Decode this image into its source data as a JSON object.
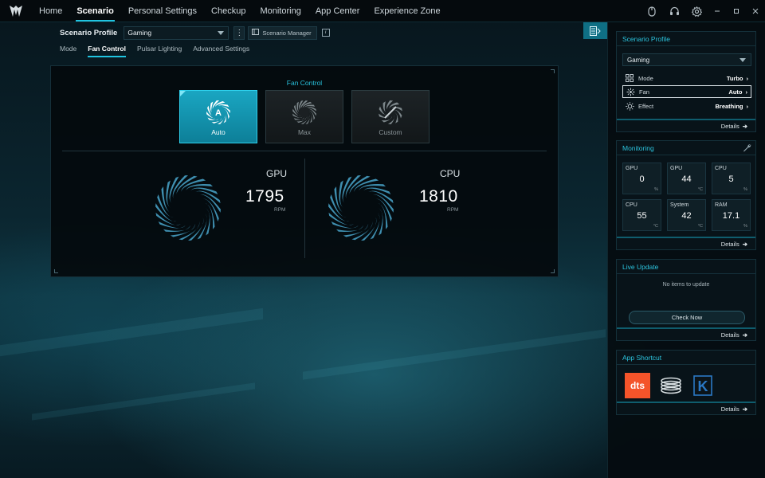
{
  "nav": {
    "items": [
      {
        "label": "Home",
        "active": false
      },
      {
        "label": "Scenario",
        "active": true
      },
      {
        "label": "Personal Settings",
        "active": false
      },
      {
        "label": "Checkup",
        "active": false
      },
      {
        "label": "Monitoring",
        "active": false
      },
      {
        "label": "App Center",
        "active": false
      },
      {
        "label": "Experience Zone",
        "active": false
      }
    ],
    "icons": [
      "mouse-icon",
      "headset-icon",
      "settings-icon"
    ],
    "window_controls": [
      "minimize-icon",
      "restore-icon",
      "close-icon"
    ]
  },
  "profile": {
    "label": "Scenario Profile",
    "selected": "Gaming",
    "manager_label": "Scenario Manager"
  },
  "subtabs": [
    {
      "label": "Mode",
      "active": false
    },
    {
      "label": "Fan Control",
      "active": true
    },
    {
      "label": "Pulsar Lighting",
      "active": false
    },
    {
      "label": "Advanced Settings",
      "active": false
    }
  ],
  "fan_control": {
    "title": "Fan Control",
    "modes": [
      {
        "label": "Auto",
        "active": true
      },
      {
        "label": "Max",
        "active": false
      },
      {
        "label": "Custom",
        "active": false
      }
    ],
    "fans": [
      {
        "name": "GPU",
        "rpm": "1795",
        "unit": "RPM"
      },
      {
        "name": "CPU",
        "rpm": "1810",
        "unit": "RPM"
      }
    ]
  },
  "rail": {
    "scenario": {
      "title": "Scenario Profile",
      "selected": "Gaming",
      "rows": [
        {
          "label": "Mode",
          "value": "Turbo",
          "icon": "grid-icon"
        },
        {
          "label": "Fan",
          "value": "Auto",
          "icon": "fan-icon"
        },
        {
          "label": "Effect",
          "value": "Breathing",
          "icon": "sun-icon"
        }
      ],
      "details": "Details"
    },
    "monitoring": {
      "title": "Monitoring",
      "tiles": [
        {
          "name": "GPU",
          "value": "0",
          "unit": "%"
        },
        {
          "name": "GPU",
          "value": "44",
          "unit": "°C"
        },
        {
          "name": "CPU",
          "value": "5",
          "unit": "%"
        },
        {
          "name": "CPU",
          "value": "55",
          "unit": "°C"
        },
        {
          "name": "System",
          "value": "42",
          "unit": "°C"
        },
        {
          "name": "RAM",
          "value": "17.1",
          "unit": "%"
        }
      ],
      "details": "Details"
    },
    "live_update": {
      "title": "Live Update",
      "empty_text": "No items to update",
      "check_label": "Check Now",
      "details": "Details"
    },
    "shortcut": {
      "title": "App Shortcut",
      "dts_label": "dts",
      "k_label": "K",
      "details": "Details"
    }
  },
  "colors": {
    "accent": "#20c4e0",
    "active_button": "#1aa6c2",
    "dts_orange": "#f4542a",
    "k_blue": "#2a78c4"
  }
}
